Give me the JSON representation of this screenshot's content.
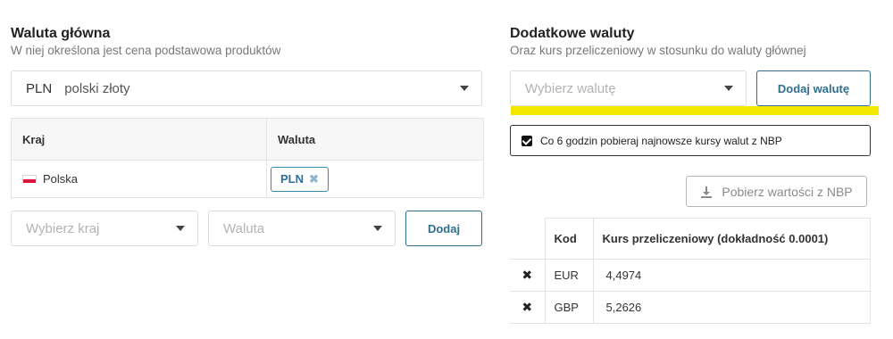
{
  "main_currency": {
    "title": "Waluta główna",
    "subtitle": "W niej określona jest cena podstawowa produktów",
    "select": {
      "code": "PLN",
      "name": "polski złoty"
    },
    "table": {
      "headers": [
        "Kraj",
        "Waluta"
      ],
      "rows": [
        {
          "country": "Polska",
          "currency_tag": "PLN"
        }
      ]
    },
    "add_row": {
      "country_placeholder": "Wybierz kraj",
      "currency_placeholder": "Waluta",
      "add_label": "Dodaj"
    }
  },
  "extra_currencies": {
    "title": "Dodatkowe waluty",
    "subtitle": "Oraz kurs przeliczeniowy w stosunku do waluty głównej",
    "select_placeholder": "Wybierz walutę",
    "add_label": "Dodaj walutę",
    "auto_fetch_label": "Co 6 godzin pobieraj najnowsze kursy walut z NBP",
    "auto_fetch_checked": true,
    "fetch_button_label": "Pobierz wartości z NBP",
    "table": {
      "headers": [
        "",
        "Kod",
        "Kurs przeliczeniowy (dokładność 0.0001)"
      ],
      "rows": [
        {
          "code": "EUR",
          "rate": "4,4974"
        },
        {
          "code": "GBP",
          "rate": "5,2626"
        }
      ]
    }
  },
  "colors": {
    "accent": "#2f6f8f",
    "highlight": "#f5e800",
    "tag_border": "#3a88b0"
  }
}
